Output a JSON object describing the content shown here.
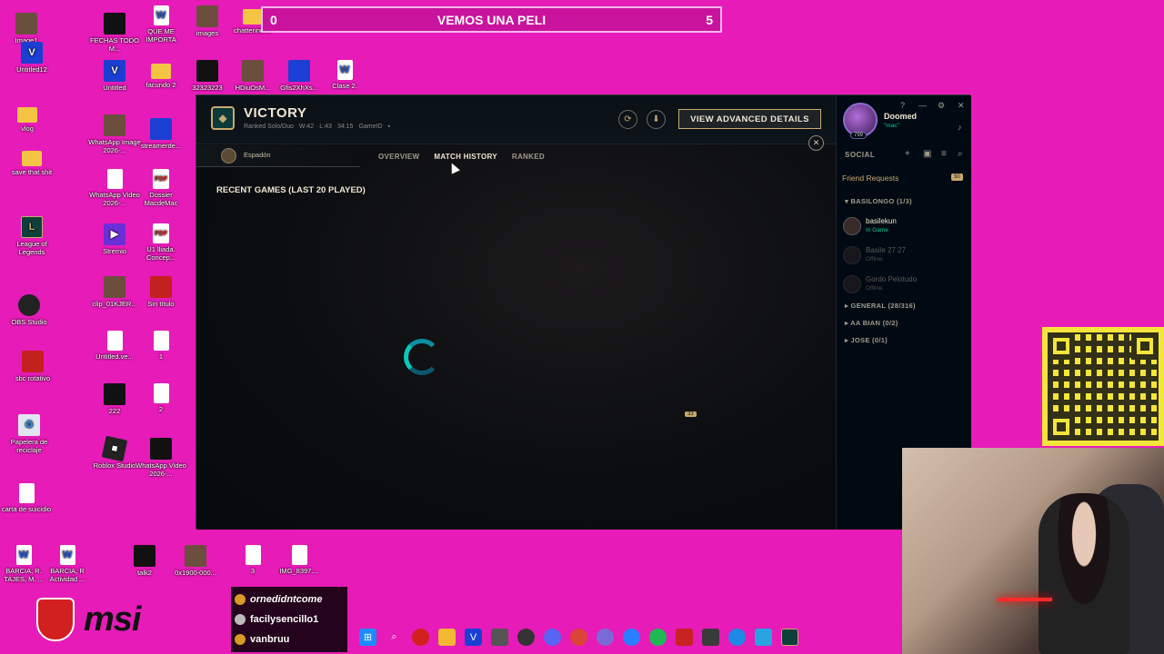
{
  "desktop": {
    "icons": [
      {
        "label": "Image1",
        "glyph": ""
      },
      {
        "label": "Untitled12",
        "glyph": "V"
      },
      {
        "label": "vlog",
        "glyph": ""
      },
      {
        "label": "save that shit",
        "glyph": ""
      },
      {
        "label": "League of Legends",
        "glyph": "L"
      },
      {
        "label": "OBS Studio",
        "glyph": ""
      },
      {
        "label": "sbc rotativo",
        "glyph": ""
      },
      {
        "label": "Papelera de reciclaje",
        "glyph": "♻"
      },
      {
        "label": "carta de suicidio",
        "glyph": ""
      },
      {
        "label": "BARCIA, R. TAJES, M. ...",
        "glyph": "W"
      },
      {
        "label": "FECHAS TODO M...",
        "glyph": ""
      },
      {
        "label": "Untitled",
        "glyph": "V"
      },
      {
        "label": "WhatsApp Image 2026-...",
        "glyph": ""
      },
      {
        "label": "WhatsApp Video 2026-...",
        "glyph": ""
      },
      {
        "label": "Stremio",
        "glyph": "▶"
      },
      {
        "label": "clip_01KJER...",
        "glyph": ""
      },
      {
        "label": "Untitled.ve...",
        "glyph": ""
      },
      {
        "label": "222",
        "glyph": ""
      },
      {
        "label": "Roblox Studio",
        "glyph": "■"
      },
      {
        "label": "BARCIA, R Actividad ...",
        "glyph": "W"
      },
      {
        "label": "QUE ME IMPORTA",
        "glyph": "W"
      },
      {
        "label": "facundo 2",
        "glyph": ""
      },
      {
        "label": "streamerde...",
        "glyph": ""
      },
      {
        "label": "Dossier MacdeMac",
        "glyph": "PDF"
      },
      {
        "label": "U1 lliada. Concep...",
        "glyph": "PDF"
      },
      {
        "label": "Sin título",
        "glyph": ""
      },
      {
        "label": "1",
        "glyph": ""
      },
      {
        "label": "2",
        "glyph": ""
      },
      {
        "label": "WhatsApp Video 2026-...",
        "glyph": ""
      },
      {
        "label": "talk2",
        "glyph": ""
      },
      {
        "label": "images",
        "glyph": ""
      },
      {
        "label": "32323223",
        "glyph": ""
      },
      {
        "label": "HDiuOsM...",
        "glyph": ""
      },
      {
        "label": "0x1900-000...",
        "glyph": ""
      },
      {
        "label": "chatterino-...",
        "glyph": ""
      },
      {
        "label": "Gfis2XhXs...",
        "glyph": ""
      },
      {
        "label": "voicemodm...",
        "glyph": ""
      },
      {
        "label": "3",
        "glyph": ""
      },
      {
        "label": "The Outlast Trials",
        "glyph": ""
      },
      {
        "label": "Clase 2.",
        "glyph": "W"
      },
      {
        "label": "IMG_8397....",
        "glyph": ""
      }
    ]
  },
  "poll": {
    "left_count": "0",
    "title": "VEMOS UNA PELI",
    "right_count": "5"
  },
  "client": {
    "result": "VICTORY",
    "queue": "Ranked Solo/Duo",
    "record": "W:42 · L:43",
    "duration": "34:15",
    "game_id_label": "GameID",
    "advanced_button": "VIEW ADVANCED DETAILS",
    "summoner_tab": "Espadón",
    "tabs": [
      {
        "label": "OVERVIEW",
        "active": false
      },
      {
        "label": "MATCH HISTORY",
        "active": true
      },
      {
        "label": "RANKED",
        "active": false
      }
    ],
    "recent_title": "RECENT GAMES (LAST 20 PLAYED)"
  },
  "social": {
    "profile_name": "Doomed",
    "profile_status": "\"mac\"",
    "profile_level": "799",
    "label": "SOCIAL",
    "friend_requests": "Friend Requests",
    "friend_requests_count": "50",
    "groups": [
      {
        "name": "BASILONGO (1/3)",
        "expanded": true
      },
      {
        "name": "GENERAL (28/316)",
        "expanded": false
      },
      {
        "name": "AA BIAN (0/2)",
        "expanded": false
      },
      {
        "name": "JOSE (0/1)",
        "expanded": false
      }
    ],
    "friends": [
      {
        "name": "basilekun",
        "status": "In Game"
      },
      {
        "name": "Basile 27 27",
        "status": "Offline"
      },
      {
        "name": "Gordo Pelotudo",
        "status": "Offline"
      }
    ],
    "chat_count": "33"
  },
  "chat_overlay": [
    {
      "user": "ornedidntcome"
    },
    {
      "user": "facilysencillo1"
    },
    {
      "user": "vanbruu"
    }
  ],
  "brand": {
    "logo_text": "msi"
  },
  "colors": {
    "desktop_bg": "#e61bb8",
    "gold": "#c8aa6e",
    "teal": "#0ac8b9"
  }
}
